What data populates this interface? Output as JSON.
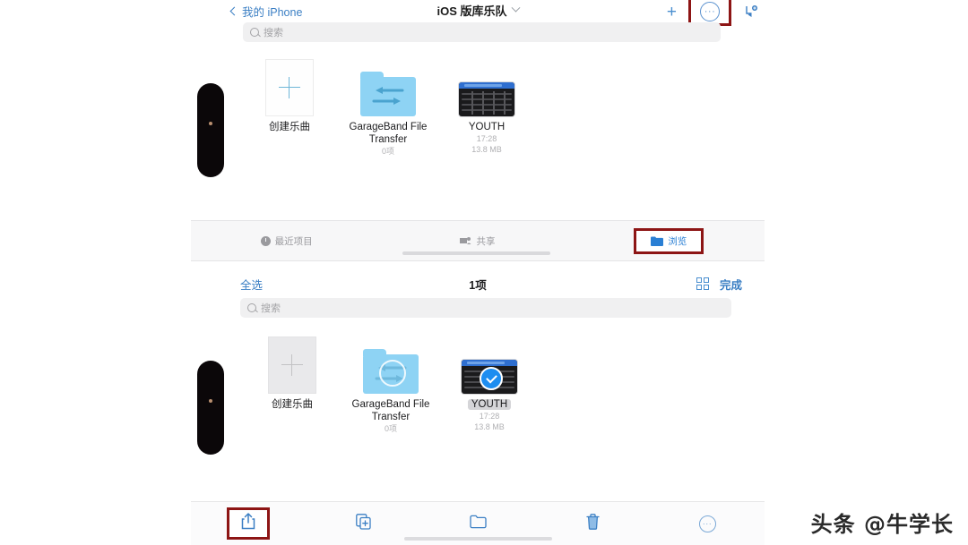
{
  "top_nav": {
    "back_label": "我的 iPhone",
    "title": "iOS 版库乐队",
    "add_icon": "+",
    "more_icon": "···"
  },
  "search": {
    "placeholder_top": "搜索",
    "placeholder_bottom": "搜索"
  },
  "top_grid": [
    {
      "label": "创建乐曲",
      "sub1": "",
      "sub2": "",
      "type": "new-song"
    },
    {
      "label": "GarageBand File Transfer",
      "sub1": "0项",
      "sub2": "",
      "type": "folder"
    },
    {
      "label": "YOUTH",
      "sub1": "17:28",
      "sub2": "13.8 MB",
      "type": "song"
    }
  ],
  "tabbar": {
    "tabs": [
      {
        "label": "最近项目",
        "icon": "clock-icon",
        "active": false
      },
      {
        "label": "共享",
        "icon": "people-icon",
        "active": false
      },
      {
        "label": "浏览",
        "icon": "folder-icon",
        "active": true
      }
    ]
  },
  "selection_bar": {
    "select_all": "全选",
    "count": "1项",
    "grid_icon": "grid-view-icon",
    "done": "完成"
  },
  "bottom_grid": [
    {
      "label": "创建乐曲",
      "sub1": "",
      "sub2": "",
      "type": "new-song-dim"
    },
    {
      "label": "GarageBand File Transfer",
      "sub1": "0项",
      "sub2": "",
      "type": "folder-sync"
    },
    {
      "label": "YOUTH",
      "sub1": "17:28",
      "sub2": "13.8 MB",
      "type": "song-selected"
    }
  ],
  "bottom_toolbar": [
    {
      "icon": "share-icon",
      "highlighted": true
    },
    {
      "icon": "duplicate-icon",
      "highlighted": false
    },
    {
      "icon": "move-to-folder-icon",
      "highlighted": false
    },
    {
      "icon": "trash-icon",
      "highlighted": false
    },
    {
      "icon": "more-circle-icon",
      "highlighted": false
    }
  ],
  "watermark": "头条 @牛学长",
  "colors": {
    "accent_blue": "#2a7fd4",
    "highlight_red": "#8d1515",
    "folder_blue": "#8ed3f4",
    "check_blue": "#1d8df0"
  }
}
